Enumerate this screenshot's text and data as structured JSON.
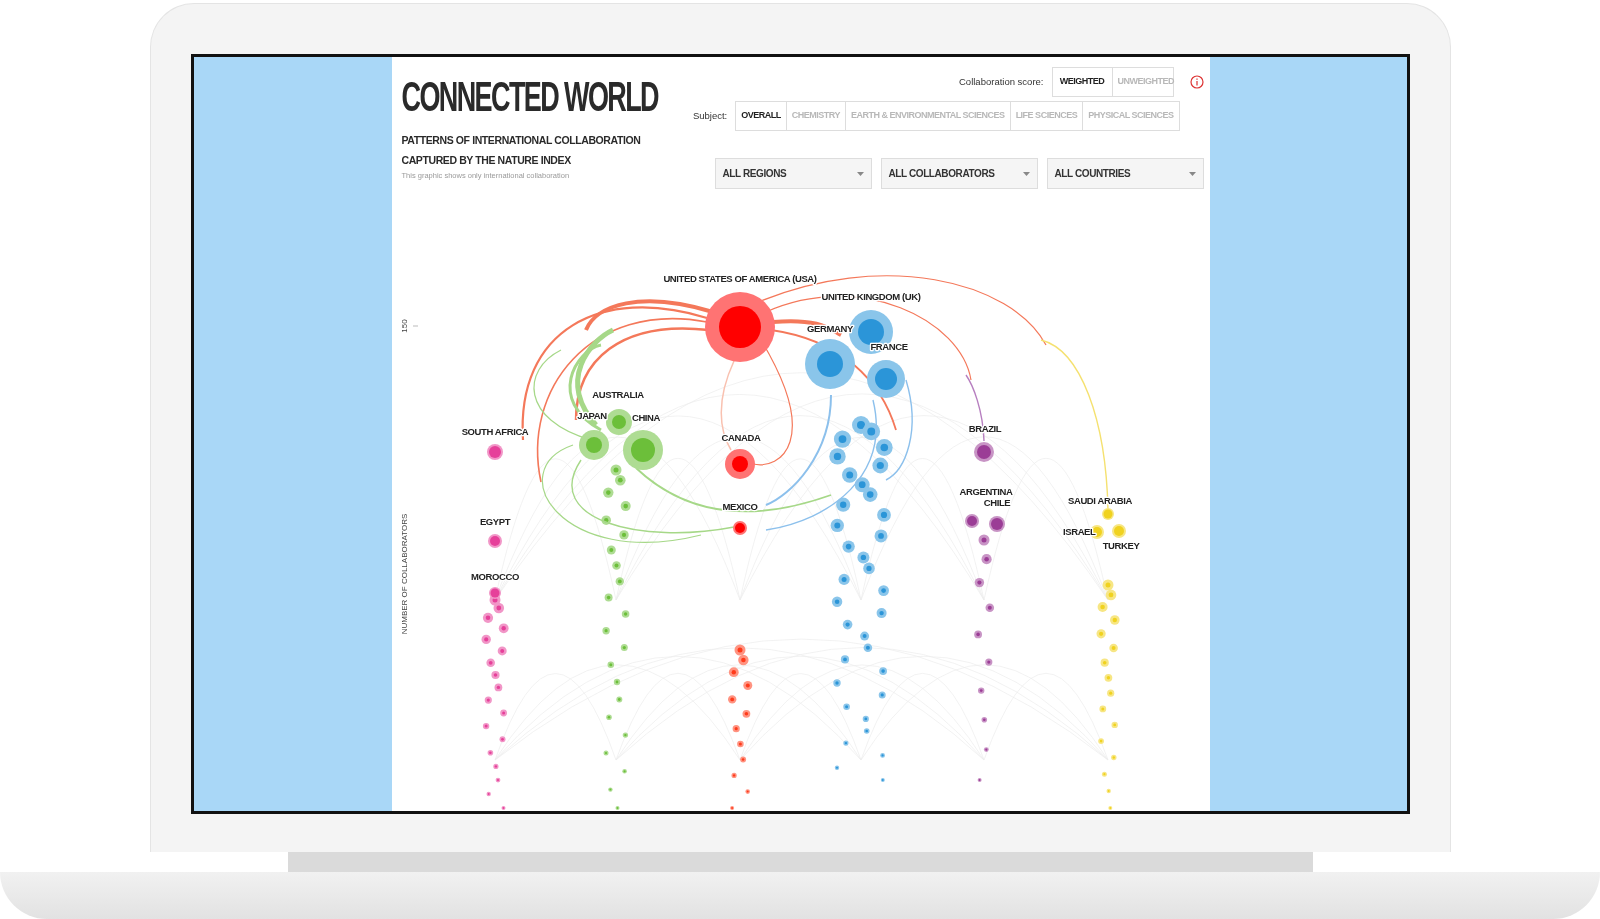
{
  "header": {
    "title": "CONNECTED WORLD",
    "subtitle": "PATTERNS OF INTERNATIONAL COLLABORATION\nCAPTURED BY THE NATURE INDEX",
    "note": "This graphic shows only international collaboration"
  },
  "score": {
    "label": "Collaboration score:",
    "options": [
      {
        "label": "WEIGHTED",
        "selected": true
      },
      {
        "label": "UNWEIGHTED",
        "selected": false
      }
    ]
  },
  "subject": {
    "label": "Subject:",
    "tabs": [
      {
        "label": "OVERALL",
        "selected": true
      },
      {
        "label": "CHEMISTRY",
        "selected": false
      },
      {
        "label": "EARTH & ENVIRONMENTAL SCIENCES",
        "selected": false
      },
      {
        "label": "LIFE SCIENCES",
        "selected": false
      },
      {
        "label": "PHYSICAL SCIENCES",
        "selected": false
      }
    ]
  },
  "filters": [
    {
      "value": "ALL REGIONS"
    },
    {
      "value": "ALL COLLABORATORS"
    },
    {
      "value": "ALL COUNTRIES"
    }
  ],
  "chart": {
    "axis_tick": "150",
    "axis_label": "NUMBER OF COLLABORATORS",
    "countries": [
      {
        "name": "UNITED STATES OF AMERICA (USA)",
        "color": "#ff0000"
      },
      {
        "name": "UNITED KINGDOM (UK)",
        "color": "#2b95d8"
      },
      {
        "name": "GERMANY",
        "color": "#2b95d8"
      },
      {
        "name": "FRANCE",
        "color": "#2b95d8"
      },
      {
        "name": "AUSTRALIA",
        "color": "#6cbf3a"
      },
      {
        "name": "JAPAN",
        "color": "#6cbf3a"
      },
      {
        "name": "CHINA",
        "color": "#6cbf3a"
      },
      {
        "name": "SOUTH AFRICA",
        "color": "#e6409a"
      },
      {
        "name": "CANADA",
        "color": "#ff0000"
      },
      {
        "name": "BRAZIL",
        "color": "#9b3d96"
      },
      {
        "name": "MEXICO",
        "color": "#ff0000"
      },
      {
        "name": "ARGENTINA",
        "color": "#9b3d96"
      },
      {
        "name": "CHILE",
        "color": "#9b3d96"
      },
      {
        "name": "SAUDI ARABIA",
        "color": "#f0d21f"
      },
      {
        "name": "ISRAEL",
        "color": "#f0d21f"
      },
      {
        "name": "TURKEY",
        "color": "#f0d21f"
      },
      {
        "name": "EGYPT",
        "color": "#e6409a"
      },
      {
        "name": "MOROCCO",
        "color": "#e6409a"
      }
    ]
  }
}
